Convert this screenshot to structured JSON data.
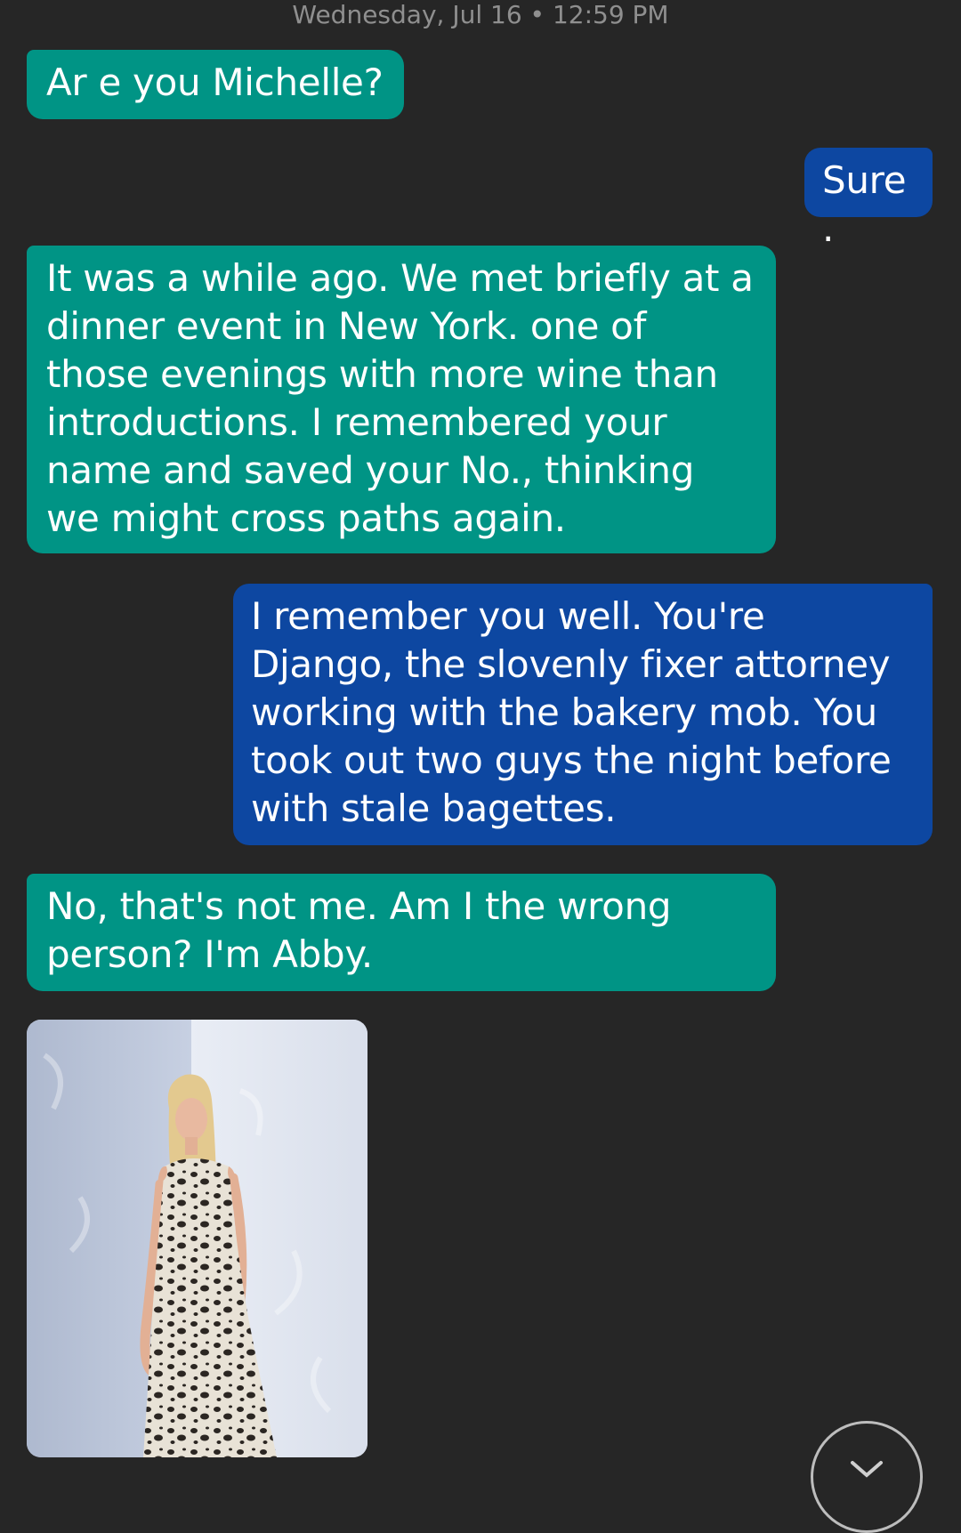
{
  "conversation": {
    "timestamp": "Wednesday, Jul 16 • 12:59 PM",
    "messages": [
      {
        "direction": "incoming",
        "text": "Ar e you Michelle?"
      },
      {
        "direction": "outgoing",
        "text": "Sure."
      },
      {
        "direction": "incoming",
        "text": "It was a while ago. We met briefly at a dinner event in New York. one of those evenings with more wine than introductions. I remembered your name and saved your No., thinking we might cross paths again."
      },
      {
        "direction": "outgoing",
        "text": "I remember you well.  You're Django, the slovenly fixer attorney working with the bakery mob.  You took out two guys the night before with stale bagettes."
      },
      {
        "direction": "incoming",
        "text": "No, that's not me. Am I the wrong person? I'm Abby."
      }
    ],
    "attachment": {
      "type": "photo",
      "icon": "woman-in-leopard-dress-photo"
    }
  },
  "controls": {
    "scroll_down_icon": "chevron-down-icon"
  },
  "colors": {
    "background": "#262626",
    "incoming_bubble": "#009485",
    "outgoing_bubble": "#0d47a1",
    "timestamp_text": "#8f8f8f"
  }
}
